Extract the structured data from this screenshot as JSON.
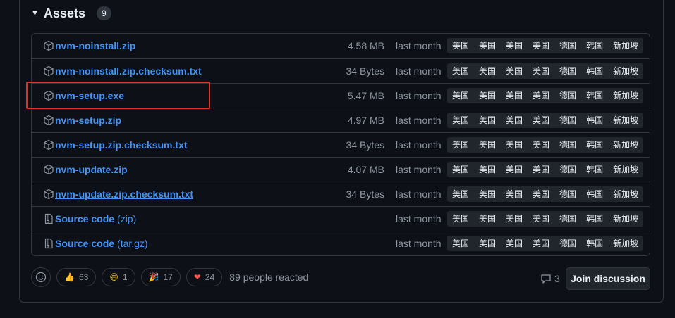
{
  "assets": {
    "title": "Assets",
    "count": "9",
    "rows": [
      {
        "name": "nvm-noinstall.zip",
        "suffix": "",
        "size": "4.58 MB",
        "date": "last month",
        "icon": "package-icon"
      },
      {
        "name": "nvm-noinstall.zip.checksum.txt",
        "suffix": "",
        "size": "34 Bytes",
        "date": "last month",
        "icon": "package-icon"
      },
      {
        "name": "nvm-setup.exe",
        "suffix": "",
        "size": "5.47 MB",
        "date": "last month",
        "icon": "package-icon"
      },
      {
        "name": "nvm-setup.zip",
        "suffix": "",
        "size": "4.97 MB",
        "date": "last month",
        "icon": "package-icon"
      },
      {
        "name": "nvm-setup.zip.checksum.txt",
        "suffix": "",
        "size": "34 Bytes",
        "date": "last month",
        "icon": "package-icon"
      },
      {
        "name": "nvm-update.zip",
        "suffix": "",
        "size": "4.07 MB",
        "date": "last month",
        "icon": "package-icon"
      },
      {
        "name": "nvm-update.zip.checksum.txt",
        "suffix": "",
        "size": "34 Bytes",
        "date": "last month",
        "icon": "package-icon"
      },
      {
        "name": "Source code",
        "suffix": "(zip)",
        "size": "",
        "date": "last month",
        "icon": "file-zip-icon"
      },
      {
        "name": "Source code",
        "suffix": "(tar.gz)",
        "size": "",
        "date": "last month",
        "icon": "file-zip-icon"
      }
    ],
    "mirrors": [
      "美国",
      "美国",
      "美国",
      "美国",
      "德国",
      "韩国",
      "新加坡"
    ]
  },
  "reactions": [
    {
      "emoji": "👍",
      "count": "63",
      "name": "thumbs-up"
    },
    {
      "emoji": "😄",
      "count": "1",
      "name": "laugh"
    },
    {
      "emoji": "🎉",
      "count": "17",
      "name": "hooray"
    },
    {
      "emoji": "❤",
      "count": "24",
      "name": "heart"
    }
  ],
  "people_reacted": "89 people reacted",
  "discussion": {
    "count": "3",
    "join_label": "Join discussion"
  },
  "colors": {
    "link": "#4493f8",
    "highlight": "#e5302a",
    "muted": "#8d96a0",
    "background": "#0d1117"
  }
}
